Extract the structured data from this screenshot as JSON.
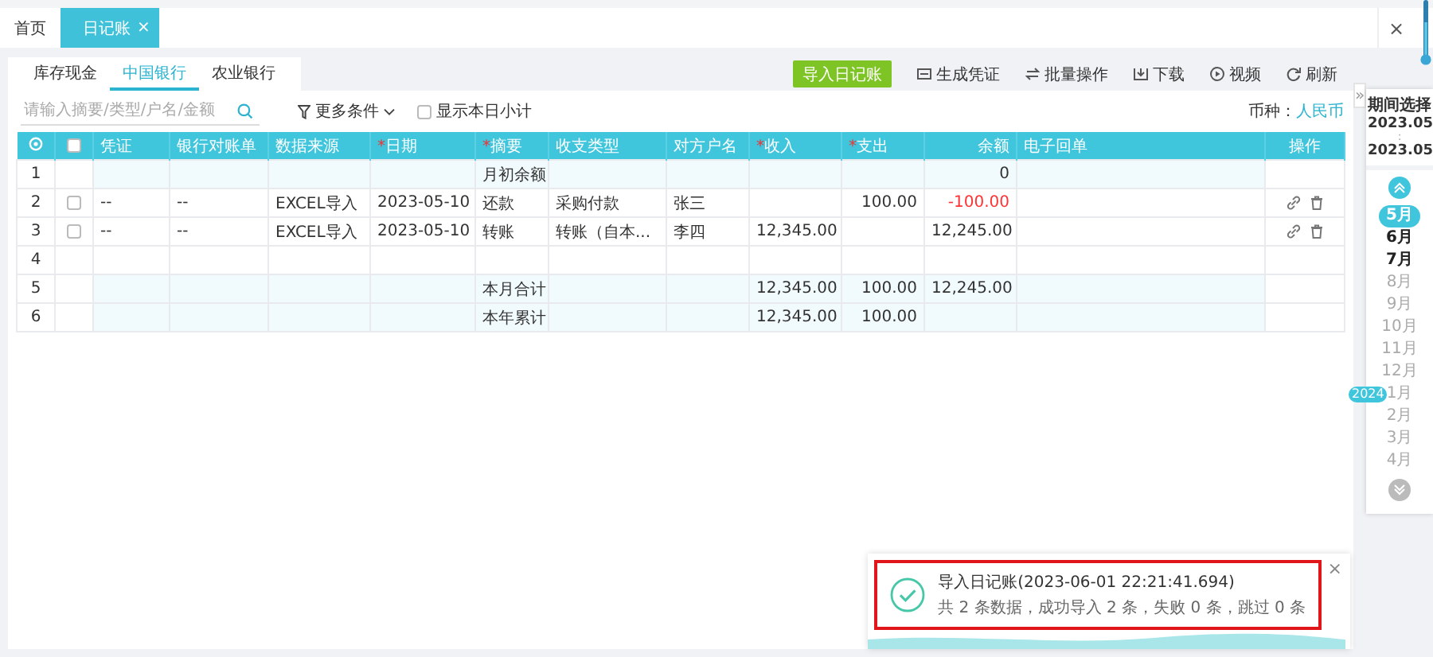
{
  "page_tabs": [
    {
      "label": "首页",
      "selected": false
    },
    {
      "label": "日记账",
      "selected": true,
      "close": "×"
    }
  ],
  "window_close": "×",
  "account_tabs": [
    {
      "label": "库存现金",
      "selected": false
    },
    {
      "label": "中国银行",
      "selected": true
    },
    {
      "label": "农业银行",
      "selected": false
    }
  ],
  "toolbar": [
    {
      "label": "导入日记账",
      "kind": "primary"
    },
    {
      "label": "生成凭证",
      "kind": "voucher"
    },
    {
      "label": "批量操作",
      "kind": "batch"
    },
    {
      "label": "下载",
      "kind": "download"
    },
    {
      "label": "视频",
      "kind": "video"
    },
    {
      "label": "刷新",
      "kind": "refresh"
    }
  ],
  "filter": {
    "search": {
      "placeholder": "请输入摘要/类型/户名/金额"
    },
    "more": "更多条件",
    "daily_subtotal": {
      "label": "显示本日小计",
      "checked": false
    },
    "currency_label": "币种：",
    "currency": "人民币"
  },
  "table": {
    "header_checked": false,
    "columns": [
      {
        "label": "凭证"
      },
      {
        "label": "银行对账单"
      },
      {
        "label": "数据来源"
      },
      {
        "label": "日期",
        "marker": "*"
      },
      {
        "label": "摘要",
        "marker": "*"
      },
      {
        "label": "收支类型"
      },
      {
        "label": "对方户名"
      },
      {
        "label": "收入",
        "marker": "*"
      },
      {
        "label": "支出",
        "marker": "*"
      },
      {
        "label": "余额"
      },
      {
        "label": "电子回单"
      },
      {
        "label": "操作"
      }
    ],
    "rows": [
      {
        "number": "1",
        "kind": "summary",
        "balance_negative": false,
        "cells": [
          null,
          null,
          null,
          null,
          "月初余额",
          null,
          null,
          null,
          null,
          "0",
          null
        ]
      },
      {
        "number": "2",
        "kind": "data",
        "checked": false,
        "balance_negative": true,
        "cells": [
          "--",
          "--",
          "EXCEL导入",
          "2023-05-10",
          "还款",
          "采购付款",
          "张三",
          null,
          "100.00",
          "-100.00",
          null
        ]
      },
      {
        "number": "3",
        "kind": "data",
        "checked": false,
        "balance_negative": false,
        "cells": [
          "--",
          "--",
          "EXCEL导入",
          "2023-05-10",
          "转账",
          "转账（自本...",
          "李四",
          "12,345.00",
          null,
          "12,245.00",
          null
        ]
      },
      {
        "number": "4",
        "kind": "empty",
        "cells": [
          null,
          null,
          null,
          null,
          null,
          null,
          null,
          null,
          null,
          null,
          null
        ]
      },
      {
        "number": "5",
        "kind": "summary",
        "balance_negative": false,
        "cells": [
          null,
          null,
          null,
          null,
          "本月合计",
          null,
          null,
          "12,345.00",
          "100.00",
          "12,245.00",
          null
        ]
      },
      {
        "number": "6",
        "kind": "summary",
        "cells": [
          null,
          null,
          null,
          null,
          "本年累计",
          null,
          null,
          "12,345.00",
          "100.00",
          null,
          null
        ]
      }
    ]
  },
  "period": {
    "expand": "»",
    "title": "期间选择",
    "start": "2023.05",
    "separator": ":",
    "end": "2023.05",
    "months": [
      {
        "label": "5月",
        "selected": true,
        "disabled": false
      },
      {
        "label": "6月",
        "selected": false,
        "disabled": false
      },
      {
        "label": "7月",
        "selected": false,
        "disabled": false
      },
      {
        "label": "8月",
        "selected": false,
        "disabled": true
      },
      {
        "label": "9月",
        "selected": false,
        "disabled": true
      },
      {
        "label": "10月",
        "selected": false,
        "disabled": true
      },
      {
        "label": "11月",
        "selected": false,
        "disabled": true
      },
      {
        "label": "12月",
        "selected": false,
        "disabled": true
      },
      {
        "label": "1月",
        "selected": false,
        "disabled": true,
        "year": "2024"
      },
      {
        "label": "2月",
        "selected": false,
        "disabled": true
      },
      {
        "label": "3月",
        "selected": false,
        "disabled": true
      },
      {
        "label": "4月",
        "selected": false,
        "disabled": true
      }
    ]
  },
  "toast": {
    "title": "导入日记账(2023-06-01 22:21:41.694)",
    "message": "共 2 条数据，成功导入 2 条，失败 0 条，跳过 0 条",
    "close": "×",
    "highlighted": true
  }
}
